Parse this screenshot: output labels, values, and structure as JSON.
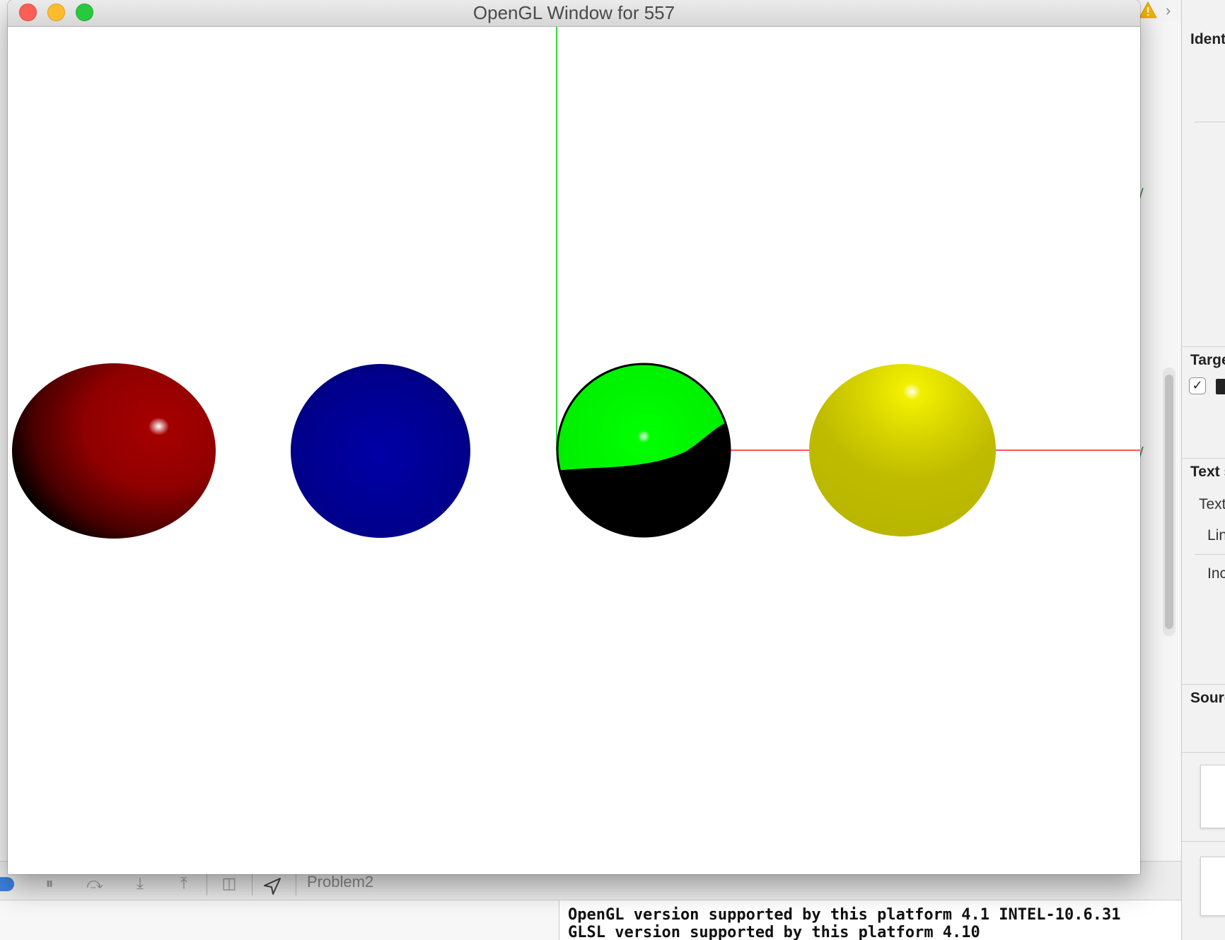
{
  "window": {
    "title": "OpenGL Window for 557"
  },
  "scene": {
    "background": "#ffffff",
    "axis_colors": {
      "x": "#ff0000",
      "y": "#00cc00"
    },
    "spheres": [
      {
        "name": "red",
        "color": "#9b0000"
      },
      {
        "name": "blue",
        "color": "#00008e"
      },
      {
        "name": "green",
        "color": "#00ff00"
      },
      {
        "name": "yellow",
        "color": "#c4c000"
      }
    ]
  },
  "inspector": {
    "sections": [
      {
        "title": "Ident"
      },
      {
        "title": "Targe"
      },
      {
        "title": "Text s"
      },
      {
        "title": "Sourc"
      }
    ],
    "text_rows": [
      "Text",
      "Lin",
      "Inc"
    ],
    "check": "✓"
  },
  "debug_bar": {
    "target": "Problem2"
  },
  "console": {
    "lines": [
      "OpenGL version supported by this platform 4.1 INTEL-10.6.31",
      "GLSL version supported by this platform 4.10"
    ]
  }
}
